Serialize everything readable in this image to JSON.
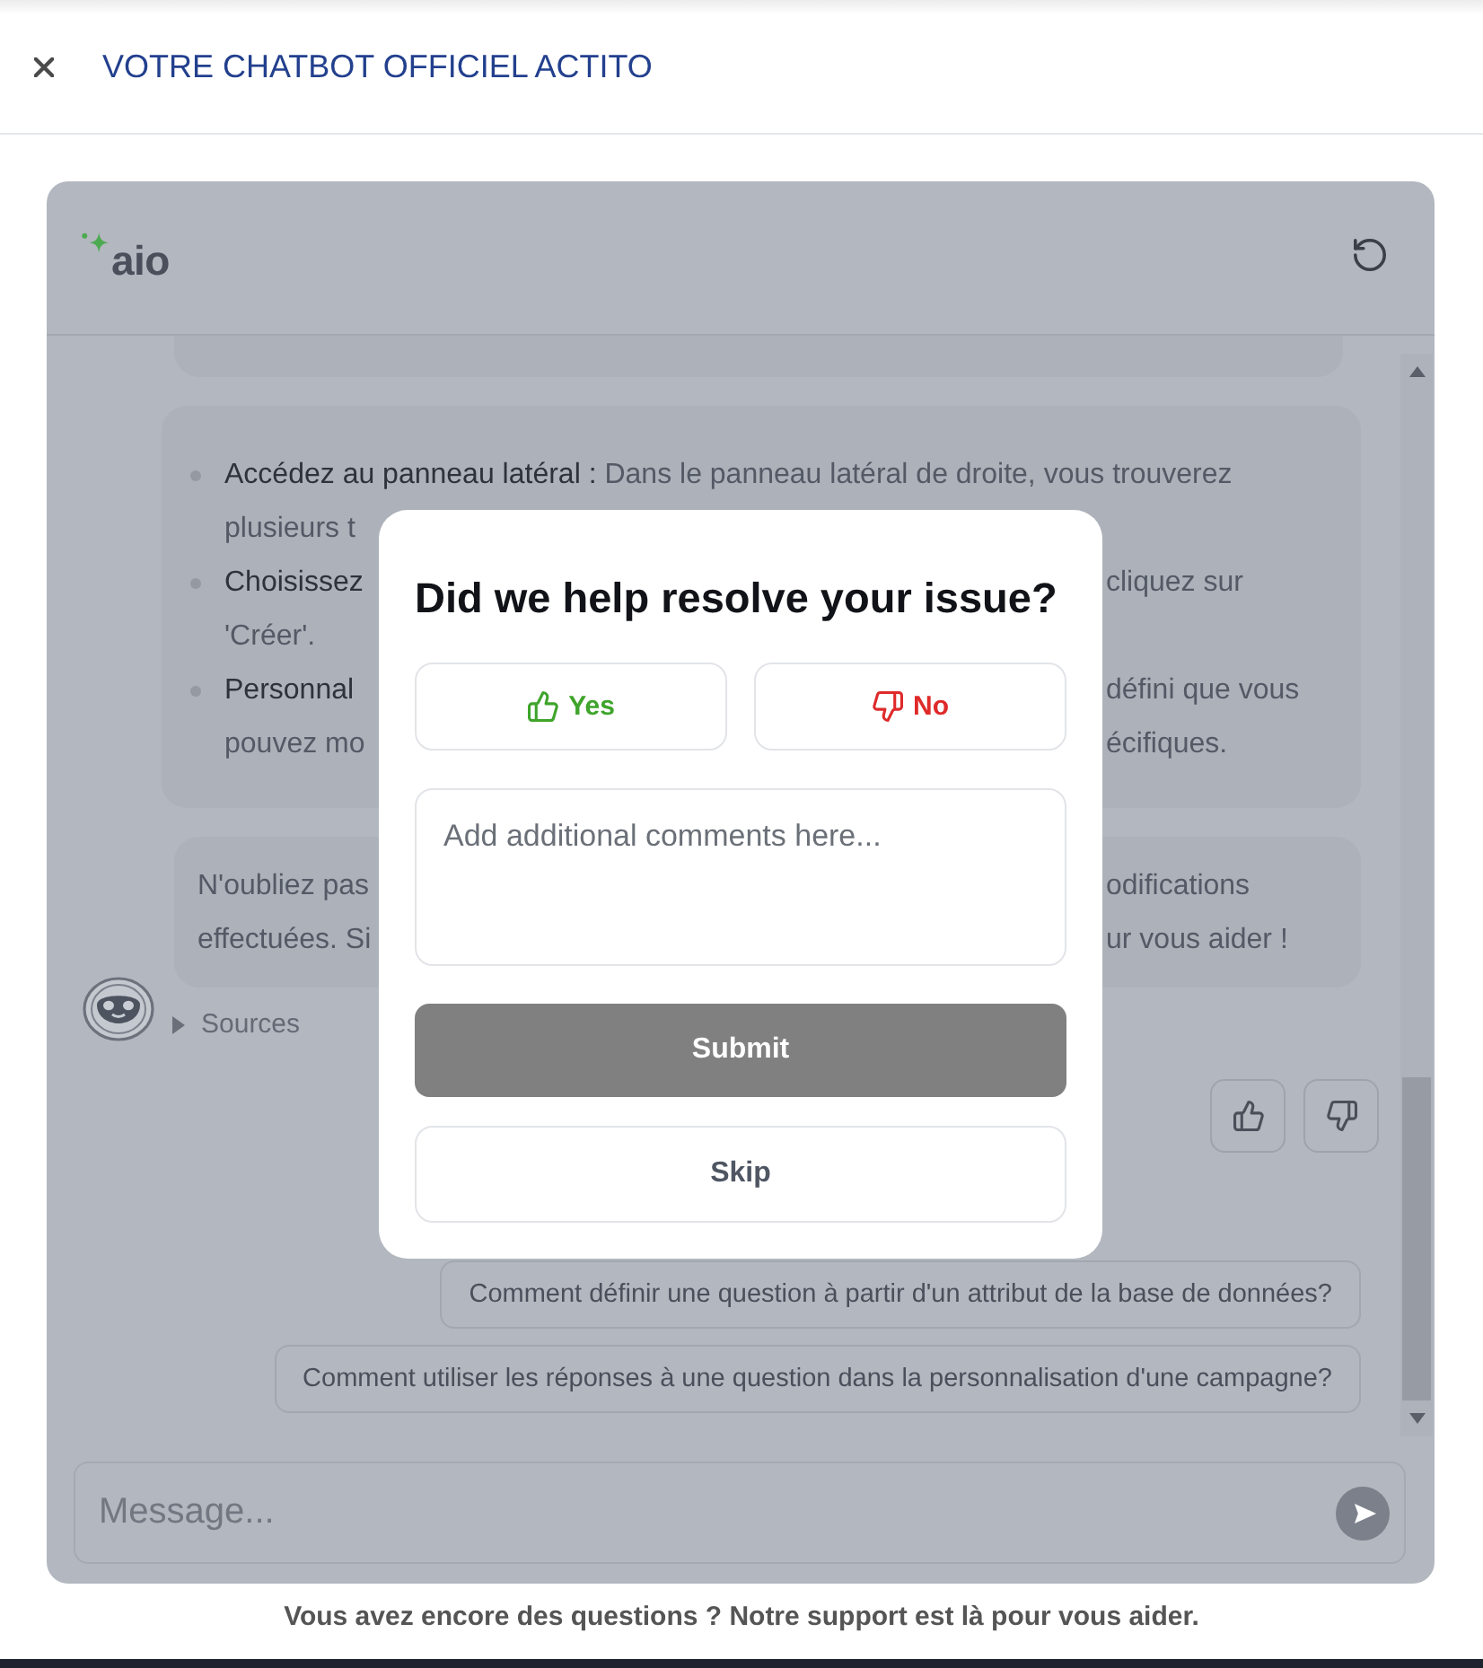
{
  "header": {
    "title": "VOTRE CHATBOT OFFICIEL ACTITO"
  },
  "chat": {
    "logo": {
      "text": "aio"
    },
    "messages": [
      {
        "kind": "partial"
      },
      {
        "kind": "list",
        "bullets": [
          {
            "lines": [
              {
                "left": "**Accédez au panneau latéral :** Dans le panneau latéral de droite, vous trouverez",
                "strong": false
              },
              {
                "left": "plusieurs t",
                "strong": false
              }
            ]
          },
          {
            "lines": [
              {
                "left": "Choisissez",
                "strong": true,
                "right": "cliquez sur"
              },
              {
                "left": "'Créer'.",
                "strong": false
              }
            ]
          },
          {
            "lines": [
              {
                "left": "Personnal",
                "strong": true,
                "right": "défini que vous"
              },
              {
                "left": "pouvez mo",
                "strong": false,
                "right": "écifiques."
              }
            ]
          }
        ]
      },
      {
        "kind": "text",
        "lines": [
          {
            "left": "N'oubliez pas",
            "strong": false,
            "right": "odifications"
          },
          {
            "left": "effectuées. Si",
            "strong": false,
            "right": "ur vous aider !"
          }
        ]
      }
    ],
    "sources": {
      "label": "Sources",
      "expanded": false
    },
    "suggestions": [
      "Comment définir une question à partir d'un attribut de la base de données?",
      "Comment utiliser les réponses à une question dans la personnalisation d'une campagne?"
    ],
    "composer": {
      "placeholder": "Message..."
    }
  },
  "feedback_dialog": {
    "title": "Did we help resolve your issue?",
    "choices": [
      {
        "kind": "yes",
        "label": "Yes",
        "selected": false
      },
      {
        "kind": "no",
        "label": "No",
        "selected": false
      }
    ],
    "comment": {
      "placeholder": "Add additional comments here..."
    },
    "submit": {
      "label": "Submit",
      "disabled": true
    },
    "skip": {
      "label": "Skip"
    }
  },
  "footer": {
    "text": "Vous avez encore des questions ? Notre support est là pour vous aider."
  }
}
